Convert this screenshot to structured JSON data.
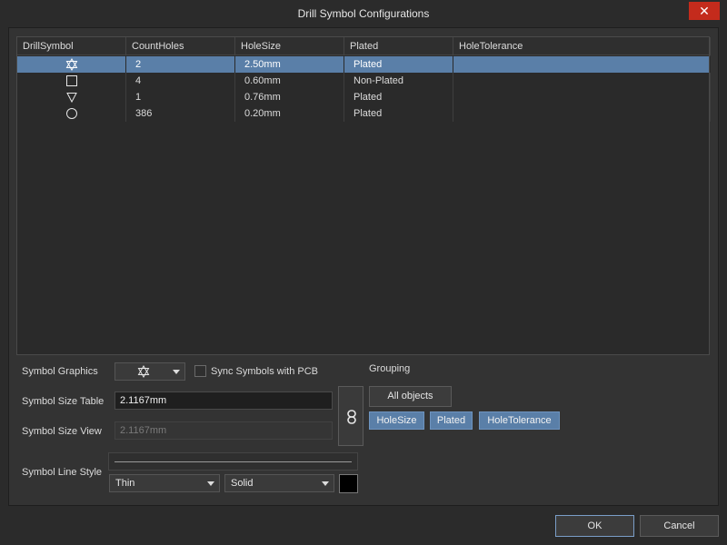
{
  "window": {
    "title": "Drill Symbol Configurations",
    "close_label": "✕"
  },
  "grid": {
    "columns": [
      "DrillSymbol",
      "CountHoles",
      "HoleSize",
      "Plated",
      "HoleTolerance"
    ],
    "rows": [
      {
        "symbol": "star-of-david-icon",
        "count": "2",
        "size": "2.50mm",
        "plated": "Plated",
        "tolerance": "",
        "selected": true
      },
      {
        "symbol": "square-icon",
        "count": "4",
        "size": "0.60mm",
        "plated": "Non-Plated",
        "tolerance": "",
        "selected": false
      },
      {
        "symbol": "triangle-down-icon",
        "count": "1",
        "size": "0.76mm",
        "plated": "Plated",
        "tolerance": "",
        "selected": false
      },
      {
        "symbol": "circle-icon",
        "count": "386",
        "size": "0.20mm",
        "plated": "Plated",
        "tolerance": "",
        "selected": false
      }
    ]
  },
  "settings": {
    "symbol_graphics_label": "Symbol Graphics",
    "symbol_graphics_value": "star-of-david-icon",
    "sync_label": "Sync Symbols with PCB",
    "sync_checked": false,
    "size_table_label": "Symbol Size Table",
    "size_table_value": "2.1167mm",
    "size_view_label": "Symbol Size View",
    "size_view_value": "2.1167mm",
    "line_style_label": "Symbol Line Style",
    "line_weight": "Thin",
    "line_type": "Solid",
    "line_color": "#000000"
  },
  "grouping": {
    "label": "Grouping",
    "all_objects": "All objects",
    "chips": [
      "HoleSize",
      "Plated",
      "HoleTolerance"
    ]
  },
  "footer": {
    "ok": "OK",
    "cancel": "Cancel"
  },
  "colors": {
    "selection": "#5a7fa8",
    "close": "#c42b1c",
    "background": "#2b2b2b"
  }
}
